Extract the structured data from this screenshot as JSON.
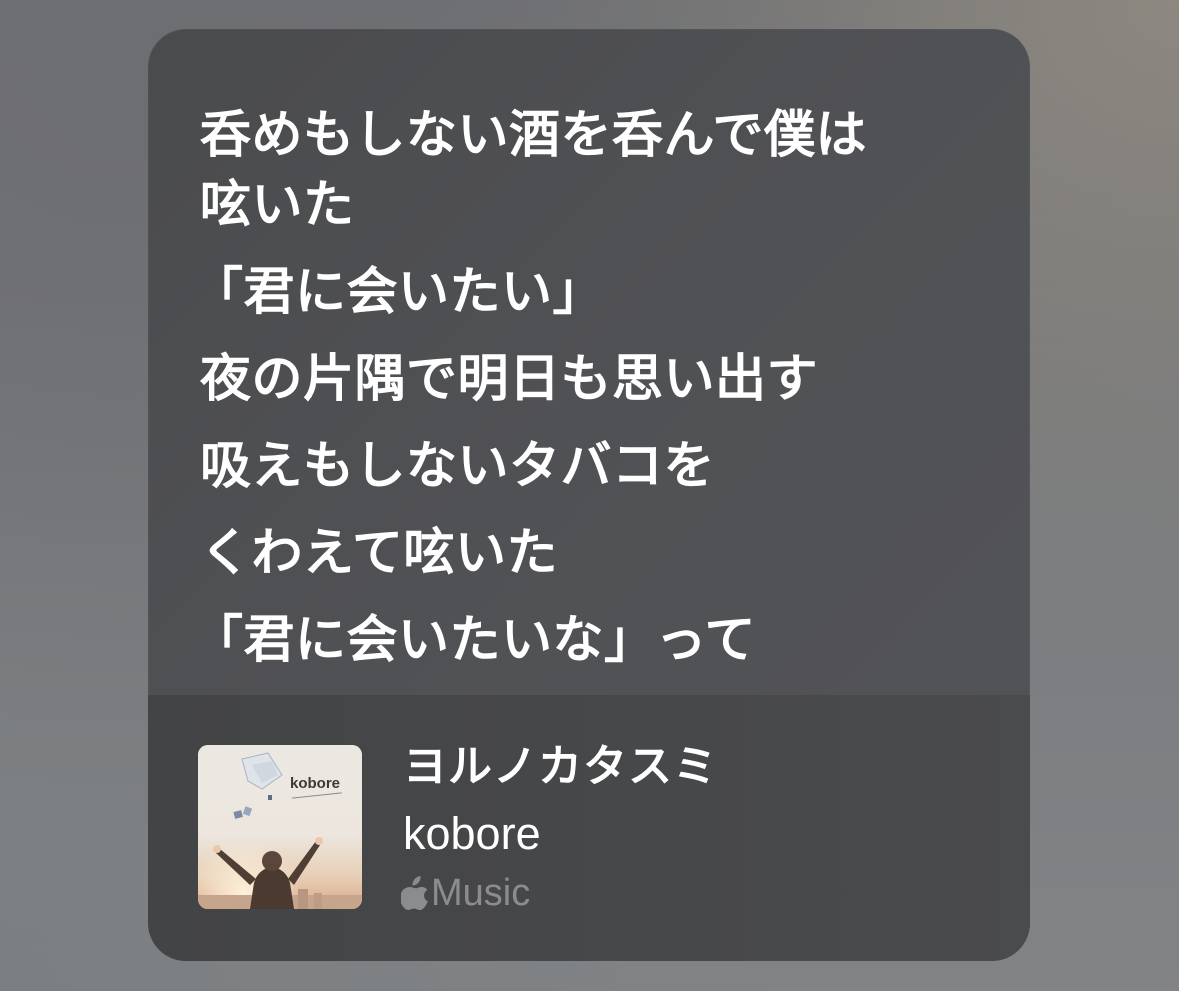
{
  "lyrics": {
    "lines": [
      "呑めもしない酒を呑んで僕は",
      "呟いた",
      "「君に会いたい」",
      "夜の片隅で明日も思い出す",
      "吸えもしないタバコを",
      "くわえて呟いた",
      "「君に会いたいな」って"
    ]
  },
  "track": {
    "title": "ヨルノカタスミ",
    "artist": "kobore",
    "artwork_logo": "kobore"
  },
  "service": {
    "icon": "apple-logo-icon",
    "label": "Music"
  },
  "colors": {
    "card_background": "#4f5053",
    "footer_background": "#454648",
    "primary_text": "#ffffff",
    "secondary_text": "#8b8c8e"
  }
}
